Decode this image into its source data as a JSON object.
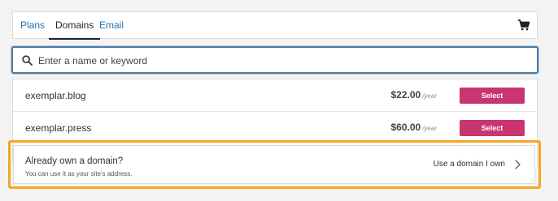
{
  "tabs": [
    {
      "label": "Plans",
      "selected": false
    },
    {
      "label": "Domains",
      "selected": true
    },
    {
      "label": "Email",
      "selected": false
    }
  ],
  "cart_icon": "shopping-cart-icon",
  "search": {
    "icon": "search-icon",
    "value": "",
    "placeholder": "Enter a name or keyword"
  },
  "results": [
    {
      "domain": "exemplar.blog",
      "price": "$22.00",
      "period": "/year",
      "button": "Select"
    },
    {
      "domain": "exemplar.press",
      "price": "$60.00",
      "period": "/year",
      "button": "Select"
    }
  ],
  "own_domain": {
    "title": "Already own a domain?",
    "subtitle": "You can use it as your site's address.",
    "action": "Use a domain I own",
    "action_icon": "chevron-right-icon"
  },
  "colors": {
    "accent": "#c9356e",
    "link": "#2271b1",
    "highlight": "#f5a623",
    "focus": "#4b7aa5"
  }
}
